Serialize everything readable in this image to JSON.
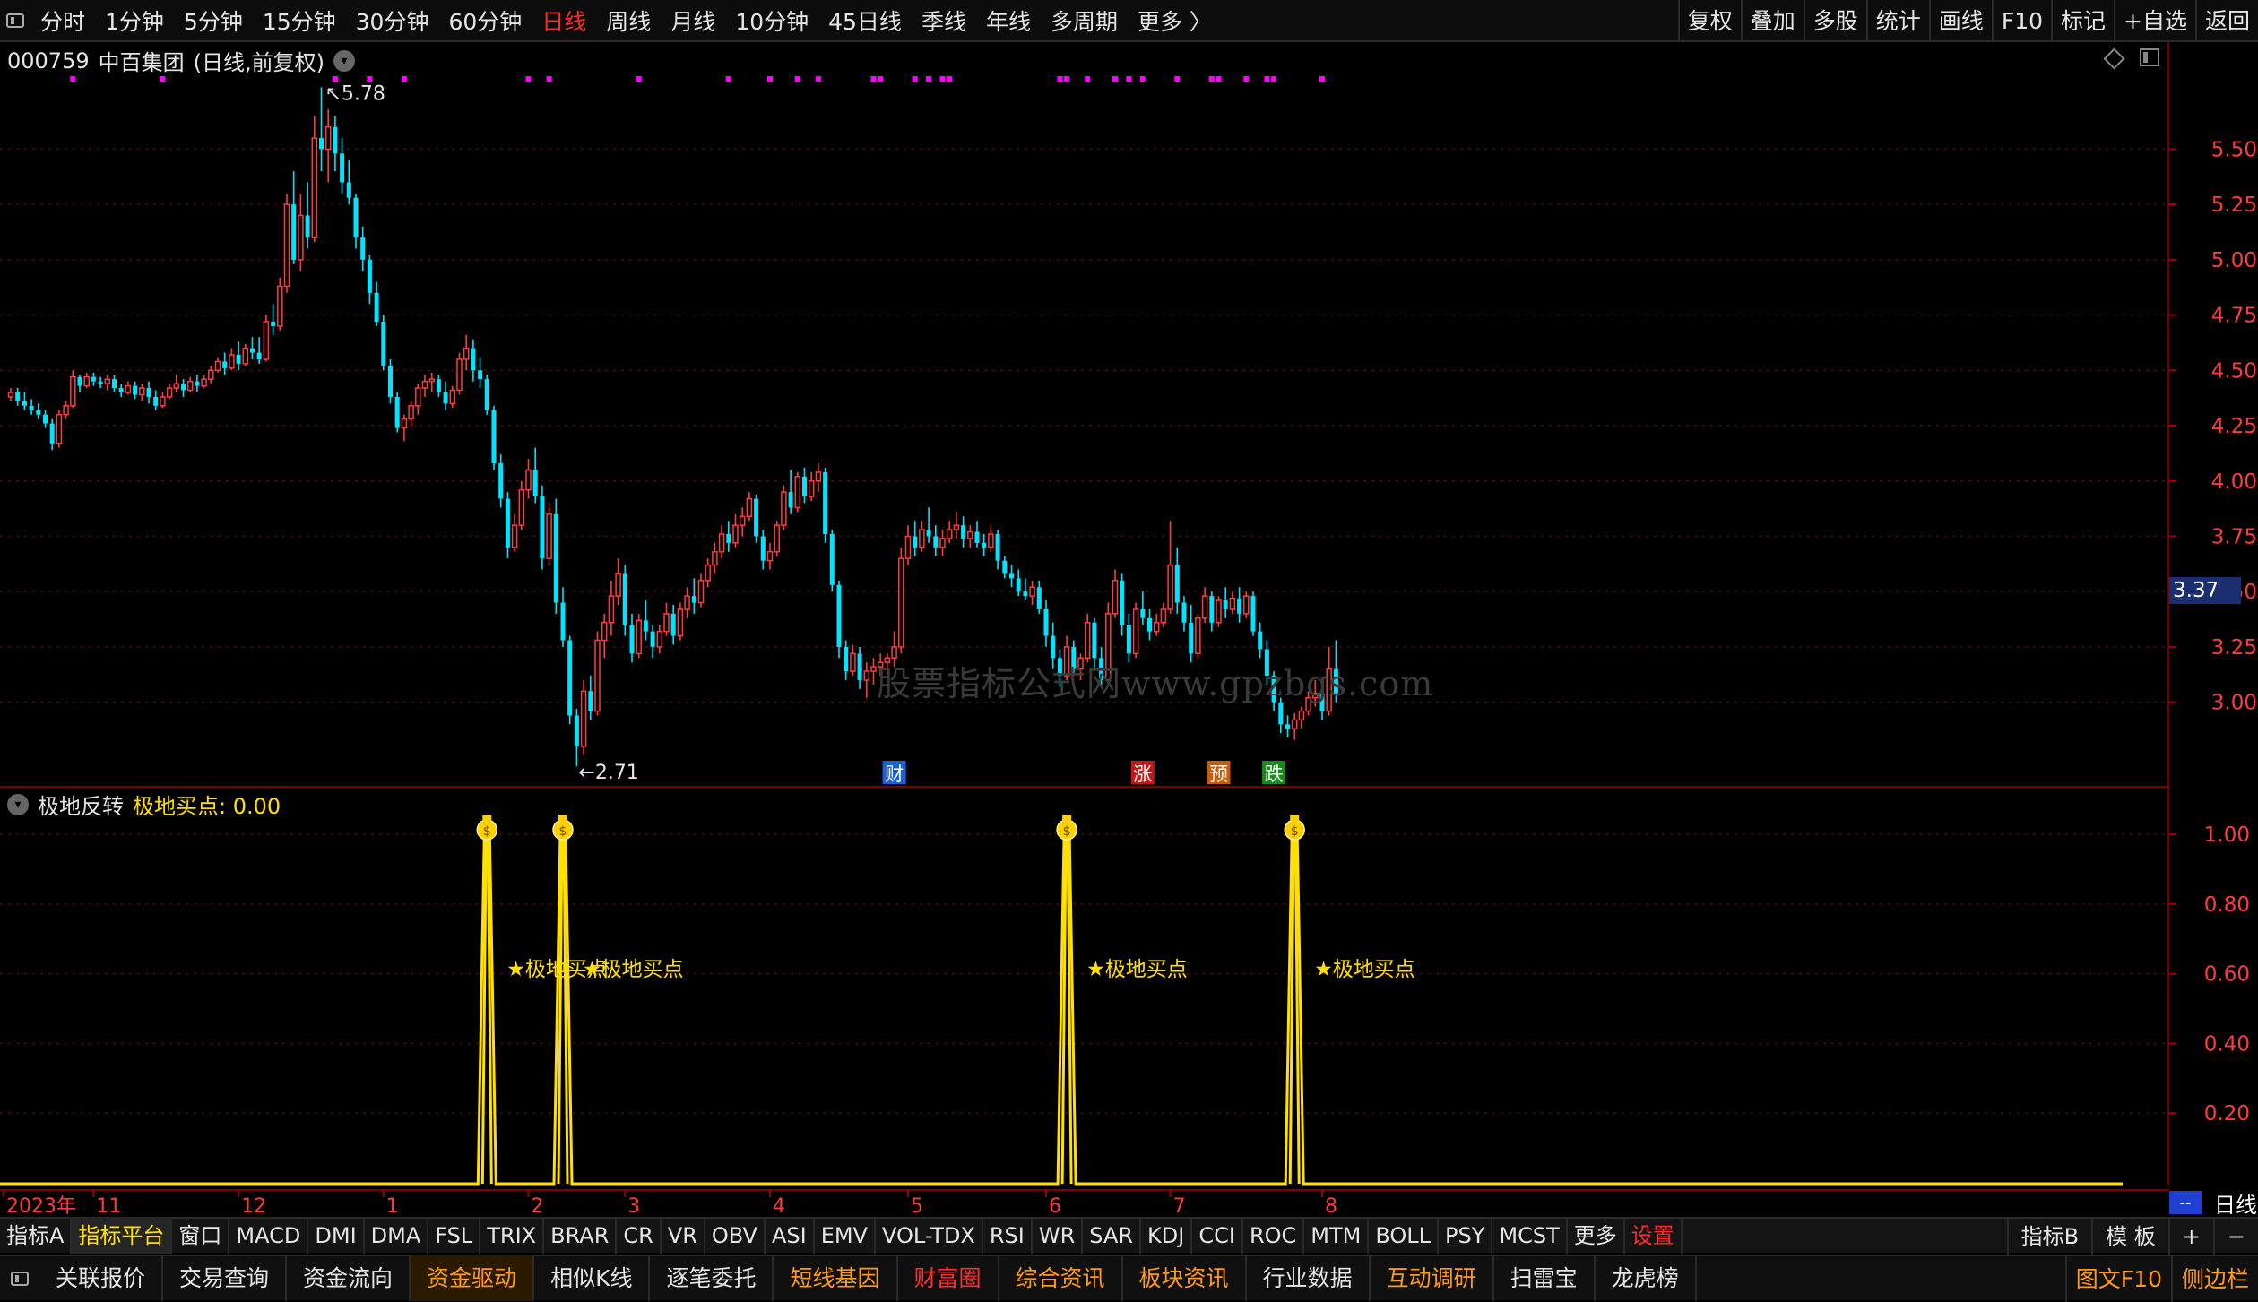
{
  "topbar": {
    "periods": [
      "分时",
      "1分钟",
      "5分钟",
      "15分钟",
      "30分钟",
      "60分钟",
      "日线",
      "周线",
      "月线",
      "10分钟",
      "45日线",
      "季线",
      "年线",
      "多周期",
      "更多 〉"
    ],
    "active_period": "日线",
    "tools": [
      "复权",
      "叠加",
      "多股",
      "统计",
      "画线",
      "F10",
      "标记",
      "+自选",
      "返回"
    ]
  },
  "stock": {
    "code": "000759",
    "name": "中百集团",
    "mode": "(日线,前复权)",
    "last_price": "3.37",
    "high_label": "5.78",
    "low_label": "2.71"
  },
  "watermark": "股票指标公式网www.gpzbgs.com",
  "events": [
    {
      "label": "财",
      "color": "#1d5fd6",
      "bar": 128
    },
    {
      "label": "涨",
      "color": "#c01818",
      "bar": 164
    },
    {
      "label": "预",
      "color": "#c85a0a",
      "bar": 175
    },
    {
      "label": "跌",
      "color": "#1a8a1a",
      "bar": 183
    }
  ],
  "indicator": {
    "name": "极地反转",
    "value_label": "极地买点: 0.00",
    "signal_text": "★极地买点",
    "signal_bars": [
      69,
      80,
      153,
      186
    ]
  },
  "date_axis": [
    "2023年",
    "11",
    "12",
    "1",
    "2",
    "3",
    "4",
    "5",
    "6",
    "7",
    "8"
  ],
  "date_axis_bars": [
    0,
    12,
    33,
    54,
    75,
    89,
    110,
    130,
    150,
    168,
    190
  ],
  "bottom_period": "日线",
  "bottom_period_dd": "--",
  "indicator_bar": {
    "items": [
      "指标A",
      "指标平台",
      "窗口",
      "MACD",
      "DMI",
      "DMA",
      "FSL",
      "TRIX",
      "BRAR",
      "CR",
      "VR",
      "OBV",
      "ASI",
      "EMV",
      "VOL-TDX",
      "RSI",
      "WR",
      "SAR",
      "KDJ",
      "CCI",
      "ROC",
      "MTM",
      "BOLL",
      "PSY",
      "MCST",
      "更多",
      "设置"
    ],
    "selected": "指标平台",
    "right": [
      "指标B",
      "模 板",
      "+",
      "−"
    ]
  },
  "func_bar": {
    "items": [
      "关联报价",
      "交易查询",
      "资金流向",
      "资金驱动",
      "相似K线",
      "逐笔委托",
      "短线基因",
      "财富圈",
      "综合资讯",
      "板块资讯",
      "行业数据",
      "互动调研",
      "扫雷宝",
      "龙虎榜"
    ],
    "right": [
      "图文F10",
      "侧边栏"
    ]
  },
  "chart_data": [
    {
      "type": "candlestick",
      "title": "000759 中百集团 (日线,前复权)",
      "y_ticks": [
        5.5,
        5.25,
        5.0,
        4.75,
        4.5,
        4.25,
        4.0,
        3.75,
        3.5,
        3.25,
        3.0
      ],
      "ylim": [
        2.63,
        5.85
      ],
      "colors": {
        "up": "#ff3b3b",
        "down": "#00e4ff",
        "marker": "#ff00ff"
      },
      "x_start": "2023-10",
      "marker_bars": [
        9,
        22,
        47,
        52,
        57,
        75,
        78,
        91,
        104,
        110,
        114,
        117,
        125,
        126,
        131,
        133,
        135,
        136,
        152,
        153,
        156,
        160,
        162,
        164,
        169,
        174,
        175,
        179,
        182,
        183,
        190
      ],
      "candles": [
        [
          4.38,
          4.42,
          4.36,
          4.4
        ],
        [
          4.4,
          4.42,
          4.34,
          4.36
        ],
        [
          4.36,
          4.4,
          4.32,
          4.34
        ],
        [
          4.34,
          4.37,
          4.3,
          4.32
        ],
        [
          4.32,
          4.35,
          4.28,
          4.3
        ],
        [
          4.3,
          4.32,
          4.24,
          4.26
        ],
        [
          4.26,
          4.28,
          4.14,
          4.17
        ],
        [
          4.17,
          4.32,
          4.15,
          4.3
        ],
        [
          4.3,
          4.36,
          4.28,
          4.34
        ],
        [
          4.34,
          4.5,
          4.33,
          4.47
        ],
        [
          4.47,
          4.48,
          4.4,
          4.43
        ],
        [
          4.43,
          4.49,
          4.42,
          4.47
        ],
        [
          4.47,
          4.49,
          4.43,
          4.45
        ],
        [
          4.45,
          4.47,
          4.42,
          4.44
        ],
        [
          4.44,
          4.48,
          4.41,
          4.46
        ],
        [
          4.46,
          4.48,
          4.4,
          4.42
        ],
        [
          4.42,
          4.44,
          4.38,
          4.4
        ],
        [
          4.4,
          4.45,
          4.39,
          4.43
        ],
        [
          4.43,
          4.45,
          4.37,
          4.39
        ],
        [
          4.39,
          4.44,
          4.36,
          4.42
        ],
        [
          4.42,
          4.45,
          4.35,
          4.38
        ],
        [
          4.38,
          4.41,
          4.32,
          4.34
        ],
        [
          4.34,
          4.4,
          4.33,
          4.38
        ],
        [
          4.38,
          4.44,
          4.37,
          4.42
        ],
        [
          4.42,
          4.48,
          4.4,
          4.44
        ],
        [
          4.44,
          4.46,
          4.38,
          4.41
        ],
        [
          4.41,
          4.47,
          4.4,
          4.45
        ],
        [
          4.45,
          4.48,
          4.4,
          4.43
        ],
        [
          4.43,
          4.48,
          4.42,
          4.46
        ],
        [
          4.46,
          4.52,
          4.44,
          4.5
        ],
        [
          4.5,
          4.56,
          4.49,
          4.54
        ],
        [
          4.54,
          4.58,
          4.48,
          4.51
        ],
        [
          4.51,
          4.6,
          4.5,
          4.57
        ],
        [
          4.57,
          4.63,
          4.5,
          4.53
        ],
        [
          4.53,
          4.62,
          4.52,
          4.6
        ],
        [
          4.6,
          4.65,
          4.55,
          4.58
        ],
        [
          4.58,
          4.65,
          4.53,
          4.55
        ],
        [
          4.55,
          4.75,
          4.54,
          4.72
        ],
        [
          4.72,
          4.8,
          4.66,
          4.7
        ],
        [
          4.7,
          4.92,
          4.68,
          4.88
        ],
        [
          4.88,
          5.3,
          4.85,
          5.25
        ],
        [
          5.25,
          5.4,
          4.98,
          5.0
        ],
        [
          5.0,
          5.3,
          4.95,
          5.2
        ],
        [
          5.2,
          5.35,
          5.05,
          5.1
        ],
        [
          5.1,
          5.65,
          5.08,
          5.55
        ],
        [
          5.55,
          5.78,
          5.4,
          5.5
        ],
        [
          5.5,
          5.68,
          5.35,
          5.6
        ],
        [
          5.6,
          5.65,
          5.4,
          5.48
        ],
        [
          5.48,
          5.55,
          5.3,
          5.35
        ],
        [
          5.35,
          5.45,
          5.25,
          5.28
        ],
        [
          5.28,
          5.3,
          5.05,
          5.1
        ],
        [
          5.1,
          5.15,
          4.95,
          5.0
        ],
        [
          5.0,
          5.02,
          4.8,
          4.85
        ],
        [
          4.85,
          4.9,
          4.7,
          4.72
        ],
        [
          4.72,
          4.75,
          4.5,
          4.52
        ],
        [
          4.52,
          4.55,
          4.35,
          4.38
        ],
        [
          4.38,
          4.4,
          4.22,
          4.24
        ],
        [
          4.24,
          4.3,
          4.18,
          4.28
        ],
        [
          4.28,
          4.36,
          4.25,
          4.34
        ],
        [
          4.34,
          4.44,
          4.3,
          4.42
        ],
        [
          4.42,
          4.48,
          4.38,
          4.45
        ],
        [
          4.45,
          4.49,
          4.4,
          4.46
        ],
        [
          4.46,
          4.48,
          4.38,
          4.4
        ],
        [
          4.4,
          4.45,
          4.32,
          4.35
        ],
        [
          4.35,
          4.43,
          4.33,
          4.41
        ],
        [
          4.41,
          4.58,
          4.39,
          4.55
        ],
        [
          4.55,
          4.66,
          4.5,
          4.6
        ],
        [
          4.6,
          4.64,
          4.45,
          4.5
        ],
        [
          4.5,
          4.56,
          4.42,
          4.46
        ],
        [
          4.46,
          4.48,
          4.3,
          4.32
        ],
        [
          4.32,
          4.34,
          4.05,
          4.08
        ],
        [
          4.08,
          4.12,
          3.88,
          3.92
        ],
        [
          3.92,
          3.95,
          3.65,
          3.7
        ],
        [
          3.7,
          3.85,
          3.68,
          3.8
        ],
        [
          3.8,
          4.0,
          3.78,
          3.96
        ],
        [
          3.96,
          4.1,
          3.92,
          4.05
        ],
        [
          4.05,
          4.15,
          3.9,
          3.93
        ],
        [
          3.93,
          3.98,
          3.6,
          3.65
        ],
        [
          3.65,
          3.9,
          3.62,
          3.85
        ],
        [
          3.85,
          3.92,
          3.4,
          3.45
        ],
        [
          3.45,
          3.52,
          3.25,
          3.28
        ],
        [
          3.28,
          3.3,
          2.9,
          2.94
        ],
        [
          2.94,
          2.97,
          2.71,
          2.8
        ],
        [
          2.8,
          3.1,
          2.76,
          3.05
        ],
        [
          3.05,
          3.12,
          2.92,
          2.96
        ],
        [
          2.96,
          3.32,
          2.94,
          3.28
        ],
        [
          3.28,
          3.4,
          3.2,
          3.36
        ],
        [
          3.36,
          3.55,
          3.3,
          3.48
        ],
        [
          3.48,
          3.65,
          3.44,
          3.58
        ],
        [
          3.58,
          3.62,
          3.3,
          3.35
        ],
        [
          3.35,
          3.4,
          3.18,
          3.22
        ],
        [
          3.22,
          3.4,
          3.2,
          3.37
        ],
        [
          3.37,
          3.46,
          3.28,
          3.32
        ],
        [
          3.32,
          3.35,
          3.2,
          3.25
        ],
        [
          3.25,
          3.35,
          3.22,
          3.32
        ],
        [
          3.32,
          3.45,
          3.3,
          3.4
        ],
        [
          3.4,
          3.44,
          3.26,
          3.3
        ],
        [
          3.3,
          3.45,
          3.28,
          3.42
        ],
        [
          3.42,
          3.52,
          3.38,
          3.48
        ],
        [
          3.48,
          3.56,
          3.4,
          3.45
        ],
        [
          3.45,
          3.58,
          3.43,
          3.55
        ],
        [
          3.55,
          3.65,
          3.52,
          3.62
        ],
        [
          3.62,
          3.72,
          3.58,
          3.68
        ],
        [
          3.68,
          3.8,
          3.65,
          3.76
        ],
        [
          3.76,
          3.82,
          3.68,
          3.72
        ],
        [
          3.72,
          3.85,
          3.7,
          3.8
        ],
        [
          3.8,
          3.88,
          3.75,
          3.84
        ],
        [
          3.84,
          3.95,
          3.82,
          3.92
        ],
        [
          3.92,
          3.94,
          3.72,
          3.75
        ],
        [
          3.75,
          3.78,
          3.6,
          3.64
        ],
        [
          3.64,
          3.72,
          3.6,
          3.68
        ],
        [
          3.68,
          3.82,
          3.66,
          3.8
        ],
        [
          3.8,
          3.98,
          3.78,
          3.95
        ],
        [
          3.95,
          4.05,
          3.85,
          3.88
        ],
        [
          3.88,
          4.04,
          3.86,
          4.02
        ],
        [
          4.02,
          4.06,
          3.9,
          3.93
        ],
        [
          3.93,
          4.04,
          3.91,
          4.0
        ],
        [
          4.0,
          4.08,
          3.95,
          4.04
        ],
        [
          4.04,
          4.06,
          3.72,
          3.76
        ],
        [
          3.76,
          3.78,
          3.5,
          3.53
        ],
        [
          3.53,
          3.55,
          3.2,
          3.25
        ],
        [
          3.25,
          3.28,
          3.1,
          3.14
        ],
        [
          3.14,
          3.26,
          3.12,
          3.22
        ],
        [
          3.22,
          3.25,
          3.06,
          3.1
        ],
        [
          3.1,
          3.18,
          3.02,
          3.14
        ],
        [
          3.14,
          3.2,
          3.08,
          3.16
        ],
        [
          3.16,
          3.22,
          3.12,
          3.18
        ],
        [
          3.18,
          3.22,
          3.13,
          3.2
        ],
        [
          3.2,
          3.32,
          3.16,
          3.25
        ],
        [
          3.25,
          3.7,
          3.22,
          3.65
        ],
        [
          3.65,
          3.8,
          3.62,
          3.75
        ],
        [
          3.75,
          3.82,
          3.66,
          3.7
        ],
        [
          3.7,
          3.82,
          3.68,
          3.78
        ],
        [
          3.78,
          3.88,
          3.72,
          3.75
        ],
        [
          3.75,
          3.8,
          3.66,
          3.7
        ],
        [
          3.7,
          3.78,
          3.66,
          3.74
        ],
        [
          3.74,
          3.82,
          3.72,
          3.78
        ],
        [
          3.78,
          3.86,
          3.74,
          3.8
        ],
        [
          3.8,
          3.84,
          3.7,
          3.74
        ],
        [
          3.74,
          3.8,
          3.7,
          3.77
        ],
        [
          3.77,
          3.82,
          3.7,
          3.72
        ],
        [
          3.72,
          3.76,
          3.66,
          3.7
        ],
        [
          3.7,
          3.8,
          3.68,
          3.76
        ],
        [
          3.76,
          3.78,
          3.6,
          3.64
        ],
        [
          3.64,
          3.66,
          3.56,
          3.58
        ],
        [
          3.58,
          3.62,
          3.52,
          3.56
        ],
        [
          3.56,
          3.6,
          3.48,
          3.5
        ],
        [
          3.5,
          3.56,
          3.46,
          3.48
        ],
        [
          3.48,
          3.55,
          3.44,
          3.52
        ],
        [
          3.52,
          3.55,
          3.4,
          3.42
        ],
        [
          3.42,
          3.46,
          3.25,
          3.3
        ],
        [
          3.3,
          3.36,
          3.15,
          3.2
        ],
        [
          3.2,
          3.24,
          3.07,
          3.12
        ],
        [
          3.12,
          3.3,
          3.1,
          3.25
        ],
        [
          3.25,
          3.28,
          3.12,
          3.15
        ],
        [
          3.15,
          3.22,
          3.1,
          3.2
        ],
        [
          3.2,
          3.4,
          3.18,
          3.36
        ],
        [
          3.36,
          3.38,
          3.15,
          3.2
        ],
        [
          3.2,
          3.25,
          3.07,
          3.1
        ],
        [
          3.1,
          3.45,
          3.08,
          3.4
        ],
        [
          3.4,
          3.6,
          3.38,
          3.55
        ],
        [
          3.55,
          3.58,
          3.3,
          3.35
        ],
        [
          3.35,
          3.4,
          3.18,
          3.22
        ],
        [
          3.22,
          3.45,
          3.2,
          3.42
        ],
        [
          3.42,
          3.5,
          3.35,
          3.38
        ],
        [
          3.38,
          3.42,
          3.28,
          3.32
        ],
        [
          3.32,
          3.4,
          3.3,
          3.36
        ],
        [
          3.36,
          3.45,
          3.34,
          3.42
        ],
        [
          3.42,
          3.82,
          3.4,
          3.62
        ],
        [
          3.62,
          3.7,
          3.4,
          3.45
        ],
        [
          3.45,
          3.48,
          3.32,
          3.36
        ],
        [
          3.36,
          3.44,
          3.18,
          3.22
        ],
        [
          3.22,
          3.4,
          3.2,
          3.38
        ],
        [
          3.38,
          3.52,
          3.36,
          3.48
        ],
        [
          3.48,
          3.5,
          3.32,
          3.36
        ],
        [
          3.36,
          3.48,
          3.34,
          3.46
        ],
        [
          3.46,
          3.52,
          3.38,
          3.42
        ],
        [
          3.42,
          3.5,
          3.4,
          3.47
        ],
        [
          3.47,
          3.52,
          3.36,
          3.4
        ],
        [
          3.4,
          3.5,
          3.38,
          3.48
        ],
        [
          3.48,
          3.5,
          3.3,
          3.32
        ],
        [
          3.32,
          3.36,
          3.2,
          3.24
        ],
        [
          3.24,
          3.28,
          3.08,
          3.12
        ],
        [
          3.12,
          3.14,
          2.96,
          3.0
        ],
        [
          3.0,
          3.02,
          2.86,
          2.9
        ],
        [
          2.9,
          2.94,
          2.84,
          2.88
        ],
        [
          2.88,
          2.95,
          2.83,
          2.92
        ],
        [
          2.92,
          2.98,
          2.88,
          2.96
        ],
        [
          2.96,
          3.05,
          2.94,
          3.02
        ],
        [
          3.02,
          3.1,
          2.98,
          3.04
        ],
        [
          3.04,
          3.06,
          2.92,
          2.96
        ],
        [
          2.96,
          3.25,
          2.94,
          3.15
        ],
        [
          3.15,
          3.28,
          3.0,
          3.04
        ]
      ]
    },
    {
      "type": "line",
      "title": "极地反转",
      "series": [
        {
          "name": "极地买点",
          "x_bars": [
            69,
            80,
            153,
            186
          ],
          "values": [
            1.0,
            1.0,
            1.0,
            1.0
          ],
          "baseline": 0.0
        }
      ],
      "y_ticks": [
        1.0,
        0.8,
        0.6,
        0.4,
        0.2
      ],
      "ylim": [
        0,
        1.08
      ],
      "color": "#ffe000"
    }
  ]
}
